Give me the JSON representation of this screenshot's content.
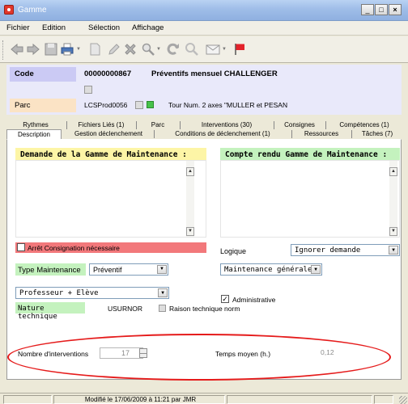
{
  "window": {
    "title": "Gamme",
    "minimize": "_",
    "maximize": "□",
    "close": "×"
  },
  "menu": [
    "Fichier",
    "Edition",
    "Sélection",
    "Affichage"
  ],
  "header": {
    "code_label": "Code",
    "code_value": "00000000867",
    "code_name": "Préventifs mensuel CHALLENGER",
    "parc_label": "Parc",
    "parc_value": "LCSProd0056",
    "parc_desc": "Tour Num. 2 axes \"MULLER et PESAN"
  },
  "tabs_top": [
    "Rythmes",
    "Fichiers Liés (1)",
    "Parc",
    "Interventions (30)",
    "Consignes",
    "Compétences (1)"
  ],
  "tabs_bottom": [
    "Description",
    "Gestion déclenchement",
    "Conditions de déclenchement (1)",
    "Ressources",
    "Tâches (7)"
  ],
  "description": {
    "demande_title": "Demande de la Gamme de Maintenance :",
    "compte_rendu_title": "Compte rendu Gamme de Maintenance :",
    "arret_label": "Arrêt Consignation  nécessaire",
    "logique_label": "Logique",
    "logique_value": "Ignorer demande",
    "type_label": "Type Maintenance",
    "type_value": "Préventif",
    "maintenance_value": "Maintenance générale",
    "professeur_value": "Professeur + Elève",
    "administrative_label": "Administrative",
    "nature_label": "Nature technique",
    "nature_value": "USURNOR",
    "raison_label": "Raison technique norm",
    "nb_interventions_label": "Nombre d'interventions",
    "nb_interventions_value": "17",
    "temps_moyen_label": "Temps moyen (h.)",
    "temps_moyen_value": "0,12"
  },
  "status": {
    "modified": "Modifié le 17/06/2009 à 11:21 par JMR"
  },
  "colors": {
    "code_label_bg": "#cbcaf4",
    "parc_label_bg": "#fbe3c5",
    "demande_bg": "#fdf5a6",
    "compte_rendu_bg": "#c4f2be",
    "arret_bg": "#f2787b",
    "highlight_oval": "#e51b1b"
  }
}
